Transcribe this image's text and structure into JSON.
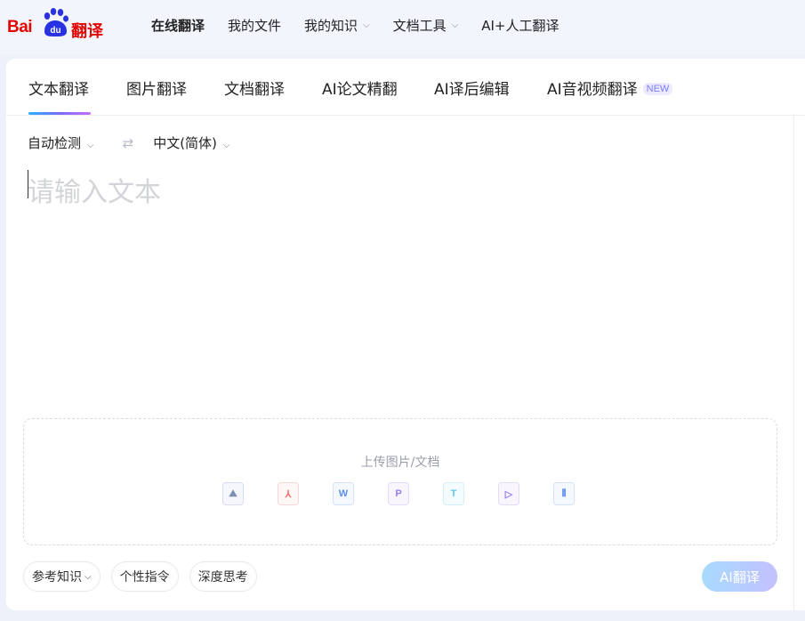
{
  "header": {
    "logo_bai": "Bai",
    "logo_du": "du",
    "logo_fanyi": "翻译",
    "nav": [
      {
        "label": "在线翻译",
        "active": true,
        "dropdown": false
      },
      {
        "label": "我的文件",
        "active": false,
        "dropdown": false
      },
      {
        "label": "我的知识",
        "active": false,
        "dropdown": true
      },
      {
        "label": "文档工具",
        "active": false,
        "dropdown": true
      },
      {
        "label": "AI+人工翻译",
        "active": false,
        "dropdown": false
      }
    ]
  },
  "tabs": [
    {
      "label": "文本翻译",
      "active": true
    },
    {
      "label": "图片翻译",
      "active": false
    },
    {
      "label": "文档翻译",
      "active": false
    },
    {
      "label": "AI论文精翻",
      "active": false
    },
    {
      "label": "AI译后编辑",
      "active": false
    },
    {
      "label": "AI音视频翻译",
      "active": false
    }
  ],
  "new_badge": "NEW",
  "language": {
    "source": "自动检测",
    "target": "中文(简体)",
    "swap_icon": "swap-arrows-icon"
  },
  "input": {
    "placeholder": "请输入文本",
    "value": ""
  },
  "upload": {
    "label": "上传图片/文档",
    "file_types": [
      {
        "name": "image-file-icon",
        "glyph": "⛰",
        "color": "#7f8fb3"
      },
      {
        "name": "pdf-file-icon",
        "glyph": "⅄",
        "color": "#f26f6f"
      },
      {
        "name": "word-file-icon",
        "glyph": "W",
        "color": "#5b8def"
      },
      {
        "name": "ppt-file-icon",
        "glyph": "P",
        "color": "#9b7bea"
      },
      {
        "name": "text-file-icon",
        "glyph": "T",
        "color": "#5cc8e6"
      },
      {
        "name": "video-file-icon",
        "glyph": "▷",
        "color": "#9b7bea"
      },
      {
        "name": "audio-file-icon",
        "glyph": "⦀",
        "color": "#5b8def"
      }
    ]
  },
  "bottom": {
    "knowledge": "参考知识",
    "instruction": "个性指令",
    "deep_think": "深度思考",
    "translate_button": "AI翻译"
  },
  "colors": {
    "brand_red": "#e10602",
    "brand_blue": "#2932e1",
    "accent_gradient_start": "#29b0ff",
    "accent_gradient_end": "#c56cff"
  }
}
